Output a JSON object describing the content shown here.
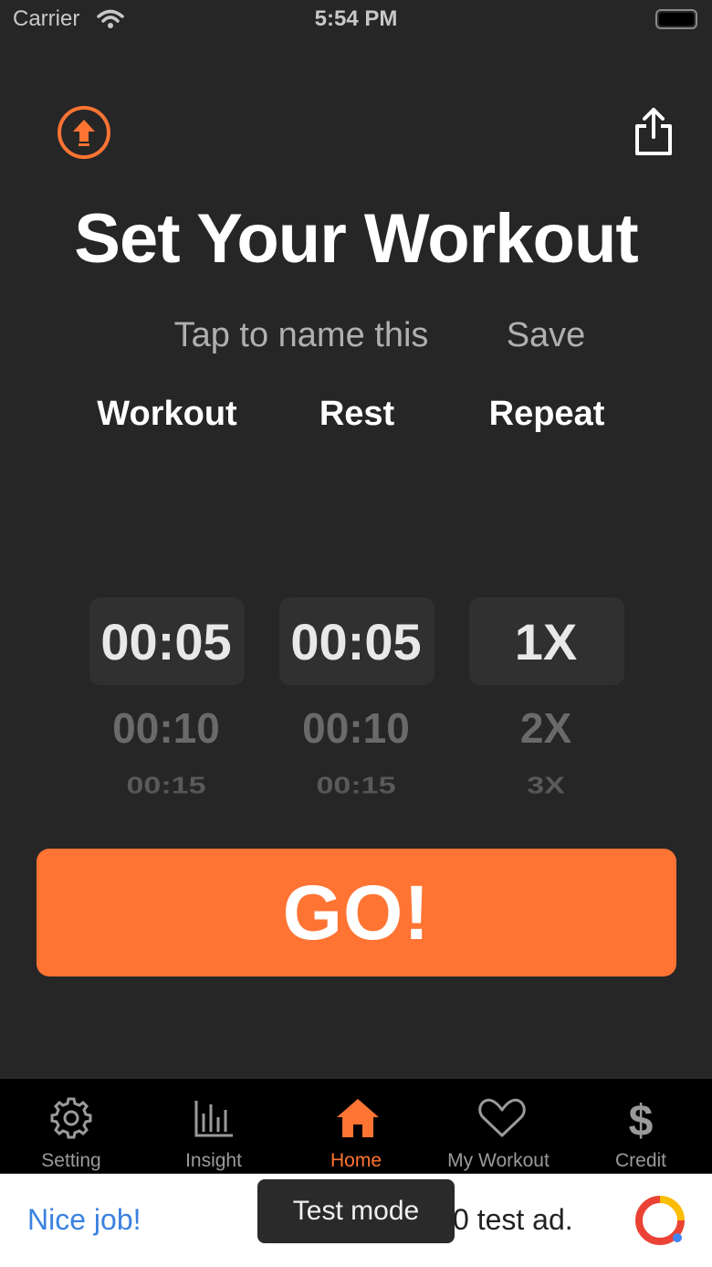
{
  "status_bar": {
    "carrier": "Carrier",
    "time": "5:54 PM"
  },
  "header": {
    "upload_icon": "upload-arrow-circle-icon",
    "share_icon": "share-icon"
  },
  "title": "Set Your Workout",
  "name_field": {
    "placeholder": "Tap to name this"
  },
  "save_label": "Save",
  "columns": {
    "workout": "Workout",
    "rest": "Rest",
    "repeat": "Repeat"
  },
  "pickers": {
    "workout": [
      "00:05",
      "00:10",
      "00:15"
    ],
    "rest": [
      "00:05",
      "00:10",
      "00:15"
    ],
    "repeat": [
      "1X",
      "2X",
      "3X"
    ]
  },
  "go_label": "GO!",
  "tabs": [
    {
      "label": "Setting",
      "icon": "gear-icon",
      "active": false
    },
    {
      "label": "Insight",
      "icon": "bar-chart-icon",
      "active": false
    },
    {
      "label": "Home",
      "icon": "home-icon",
      "active": true
    },
    {
      "label": "My Workout",
      "icon": "heart-icon",
      "active": false
    },
    {
      "label": "Credit",
      "icon": "dollar-icon",
      "active": false
    }
  ],
  "ad": {
    "headline": "Nice job!",
    "body": "0 test ad.",
    "toast": "Test mode"
  },
  "colors": {
    "accent": "#ff7433",
    "background": "#262626",
    "tab_bar": "#000000",
    "ad_link": "#3b82e0"
  }
}
